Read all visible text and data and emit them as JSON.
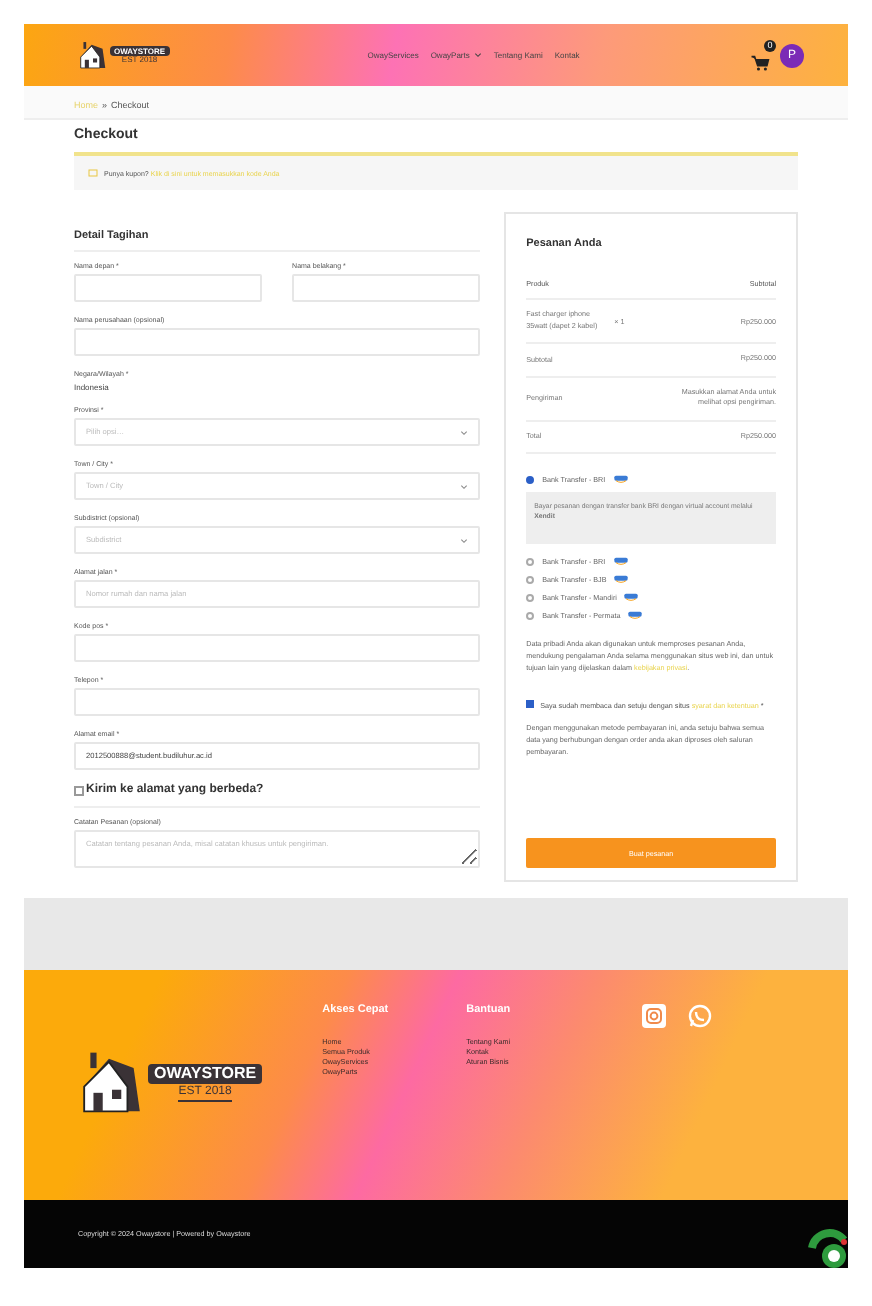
{
  "header": {
    "logo": {
      "name": "OWAYSTORE",
      "tagline": "EST 2018"
    },
    "nav": [
      {
        "label": "OwayServices",
        "dropdown": false
      },
      {
        "label": "OwayParts",
        "dropdown": true
      },
      {
        "label": "Tentang Kami",
        "dropdown": false
      },
      {
        "label": "Kontak",
        "dropdown": false
      }
    ],
    "cart_count": "0",
    "avatar": "P"
  },
  "breadcrumb": {
    "items": [
      "Home",
      "Checkout"
    ],
    "separator": "»"
  },
  "title": "Checkout",
  "coupon": {
    "text": "Punya kupon?",
    "link": "Klik di sini untuk memasukkan kode Anda"
  },
  "billing": {
    "heading": "Detail Tagihan",
    "fields": [
      {
        "kind": "pair",
        "fields": [
          {
            "kind": "input",
            "label": "Nama depan *"
          },
          {
            "kind": "input",
            "label": "Nama belakang *"
          }
        ]
      },
      {
        "kind": "input",
        "label": "Nama perusahaan (opsional)"
      },
      {
        "kind": "static",
        "label": "Negara/Wilayah *",
        "value": "Indonesia"
      },
      {
        "kind": "select",
        "label": "Provinsi *",
        "placeholder": "Pilih opsi…"
      },
      {
        "kind": "select",
        "label": "Town / City *",
        "placeholder": "Town / City"
      },
      {
        "kind": "select",
        "label": "Subdistrict (opsional)",
        "placeholder": "Subdistrict"
      },
      {
        "kind": "input",
        "label": "Alamat jalan *",
        "placeholder": "Nomor rumah dan nama jalan"
      },
      {
        "kind": "input",
        "label": "Kode pos *"
      },
      {
        "kind": "input",
        "label": "Telepon *"
      },
      {
        "kind": "input",
        "label": "Alamat email *",
        "value": "2012500888@student.budiluhur.ac.id"
      }
    ],
    "ship_different": {
      "label": "Kirim ke alamat yang berbeda?",
      "checked": false
    },
    "notes": {
      "label": "Catatan Pesanan (opsional)",
      "placeholder": "Catatan tentang pesanan Anda, misal catatan khusus untuk pengiriman."
    }
  },
  "order": {
    "heading": "Pesanan Anda",
    "columns": [
      "Produk",
      "Subtotal"
    ],
    "items": [
      {
        "name": "Fast charger iphone 35watt (dapet 2 kabel)",
        "qty": "× 1",
        "subtotal": "Rp250.000"
      }
    ],
    "summary": [
      {
        "label": "Subtotal",
        "value": "Rp250.000"
      },
      {
        "label": "Pengiriman",
        "value": "Masukkan alamat Anda untuk melihat opsi pengiriman."
      },
      {
        "label": "Total",
        "value": "Rp250.000"
      }
    ]
  },
  "payment": {
    "methods": [
      {
        "label": "Bank Transfer - BRI",
        "selected": true,
        "description": "Bayar pesanan dengan transfer bank BRI dengan virtual account melalui **Xendit**"
      },
      {
        "label": "Bank Transfer - BRI",
        "selected": false
      },
      {
        "label": "Bank Transfer - BJB",
        "selected": false
      },
      {
        "label": "Bank Transfer - Mandiri",
        "selected": false
      },
      {
        "label": "Bank Transfer - Permata",
        "selected": false
      }
    ],
    "privacy": {
      "text": "Data pribadi Anda akan digunakan untuk memproses pesanan Anda, mendukung pengalaman Anda selama menggunakan situs web ini, dan untuk tujuan lain yang dijelaskan dalam ",
      "link": "kebijakan privasi",
      "end": "."
    },
    "terms": {
      "checked": true,
      "text": "Saya sudah membaca dan setuju dengan situs ",
      "link": "syarat dan ketentuan",
      "required": "*"
    },
    "gateway_note": "Dengan menggunakan metode pembayaran ini, anda setuju bahwa semua data yang berhubungan dengan order anda akan diproses oleh saluran pembayaran.",
    "button": "Buat pesanan"
  },
  "footer": {
    "logo": {
      "name": "OWAYSTORE",
      "tagline": "EST 2018"
    },
    "columns": [
      {
        "heading": "Akses Cepat",
        "links": [
          "Home",
          "Semua Produk",
          "OwayServices",
          "OwayParts"
        ]
      },
      {
        "heading": "Bantuan",
        "links": [
          "Tentang Kami",
          "Kontak",
          "Aturan Bisnis"
        ]
      }
    ],
    "copyright": "Copyright © 2024 Owaystore | Powered by Owaystore"
  }
}
